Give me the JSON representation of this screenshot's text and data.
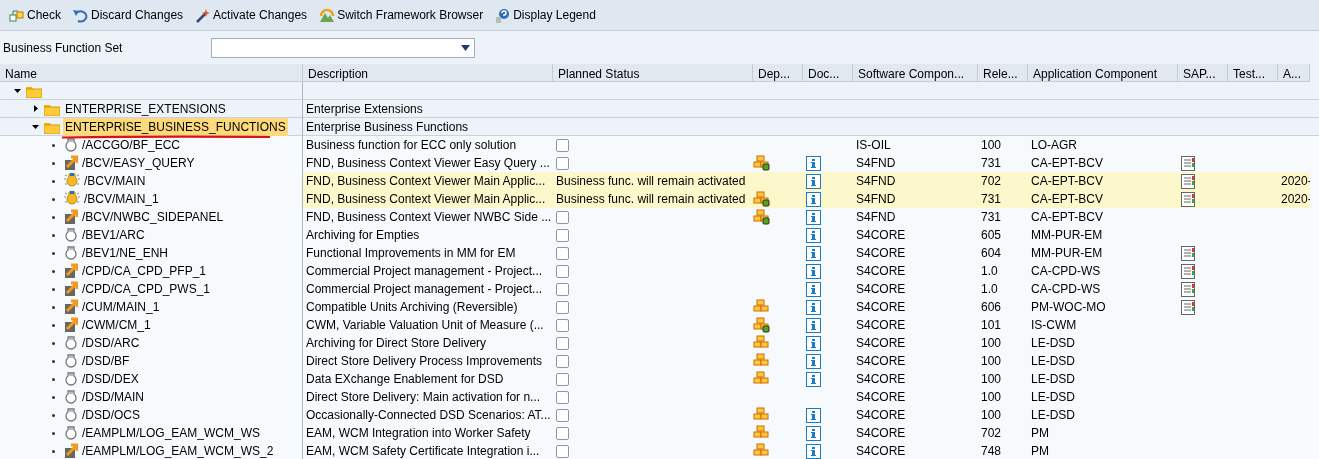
{
  "toolbar": [
    {
      "kind": "check",
      "label": "Check"
    },
    {
      "kind": "undo",
      "label": "Discard Changes"
    },
    {
      "kind": "wand",
      "label": "Activate Changes"
    },
    {
      "kind": "switch",
      "label": "Switch Framework Browser"
    },
    {
      "kind": "help",
      "label": "Display Legend"
    }
  ],
  "set_field": {
    "label": "Business Function Set"
  },
  "columns": [
    "Name",
    "Description",
    "Planned Status",
    "Dep...",
    "Doc...",
    "Software Compon...",
    "Rele...",
    "Application Component",
    "SAP...",
    "Test...",
    "A..."
  ],
  "tree": {
    "expanded": true,
    "children": [
      {
        "name": "ENTERPRISE_EXTENSIONS",
        "description": "Enterprise Extensions",
        "expanded": false,
        "selected": false
      },
      {
        "name": "ENTERPRISE_BUSINESS_FUNCTIONS",
        "description": "Enterprise Business Functions",
        "expanded": true,
        "selected": true,
        "children": [
          {
            "kind": "bulb",
            "name": "/ACCGO/BF_ECC",
            "description": "Business function for ECC only solution",
            "active": false,
            "checked": false,
            "dependent": false,
            "doc": false,
            "software": "IS-OIL",
            "release": "100",
            "component": "LO-AGR",
            "sap_note": false
          },
          {
            "kind": "switch",
            "name": "/BCV/EASY_QUERY",
            "description": "FND, Business Context Viewer Easy Query ...",
            "active": false,
            "checked": false,
            "dependent": true,
            "dependency_met": true,
            "doc": true,
            "software": "S4FND",
            "release": "731",
            "component": "CA-EPT-BCV",
            "sap_note": true
          },
          {
            "kind": "lit",
            "name": "/BCV/MAIN",
            "description": "FND, Business Context Viewer Main Applic...",
            "active": true,
            "status": "Business func. will remain activated",
            "dependent": false,
            "doc": true,
            "software": "S4FND",
            "release": "702",
            "component": "CA-EPT-BCV",
            "sap_note": true,
            "activated": "2020-"
          },
          {
            "kind": "lit",
            "name": "/BCV/MAIN_1",
            "description": "FND, Business Context Viewer Main Applic...",
            "active": true,
            "status": "Business func. will remain activated",
            "dependent": true,
            "dependency_met": true,
            "doc": true,
            "software": "S4FND",
            "release": "731",
            "component": "CA-EPT-BCV",
            "sap_note": true,
            "activated": "2020-"
          },
          {
            "kind": "switch",
            "name": "/BCV/NWBC_SIDEPANEL",
            "description": "FND, Business Context Viewer NWBC Side ...",
            "active": false,
            "checked": false,
            "dependent": true,
            "dependency_met": true,
            "doc": true,
            "software": "S4FND",
            "release": "731",
            "component": "CA-EPT-BCV",
            "sap_note": false
          },
          {
            "kind": "bulb",
            "name": "/BEV1/ARC",
            "description": "Archiving for Empties",
            "active": false,
            "checked": false,
            "dependent": false,
            "doc": true,
            "software": "S4CORE",
            "release": "605",
            "component": "MM-PUR-EM",
            "sap_note": false
          },
          {
            "kind": "bulb",
            "name": "/BEV1/NE_ENH",
            "description": "Functional Improvements in MM for EM",
            "active": false,
            "checked": false,
            "dependent": false,
            "doc": true,
            "software": "S4CORE",
            "release": "604",
            "component": "MM-PUR-EM",
            "sap_note": true
          },
          {
            "kind": "switch",
            "name": "/CPD/CA_CPD_PFP_1",
            "description": "Commercial Project management - Project...",
            "active": false,
            "checked": false,
            "dependent": false,
            "doc": true,
            "software": "S4CORE",
            "release": "1.0",
            "component": "CA-CPD-WS",
            "sap_note": true
          },
          {
            "kind": "switch",
            "name": "/CPD/CA_CPD_PWS_1",
            "description": "Commercial Project management - Project...",
            "active": false,
            "checked": false,
            "dependent": false,
            "doc": true,
            "software": "S4CORE",
            "release": "1.0",
            "component": "CA-CPD-WS",
            "sap_note": true
          },
          {
            "kind": "switch",
            "name": "/CUM/MAIN_1",
            "description": "Compatible Units Archiving (Reversible)",
            "active": false,
            "checked": false,
            "dependent": true,
            "dependency_met": false,
            "doc": true,
            "software": "S4CORE",
            "release": "606",
            "component": "PM-WOC-MO",
            "sap_note": true
          },
          {
            "kind": "switch",
            "name": "/CWM/CM_1",
            "description": "CWM, Variable Valuation Unit of Measure (...",
            "active": false,
            "checked": false,
            "dependent": true,
            "dependency_met": true,
            "doc": true,
            "software": "S4CORE",
            "release": "101",
            "component": "IS-CWM",
            "sap_note": false
          },
          {
            "kind": "bulb",
            "name": "/DSD/ARC",
            "description": "Archiving for Direct Store Delivery",
            "active": false,
            "checked": false,
            "dependent": true,
            "dependency_met": false,
            "doc": true,
            "software": "S4CORE",
            "release": "100",
            "component": "LE-DSD",
            "sap_note": false
          },
          {
            "kind": "bulb",
            "name": "/DSD/BF",
            "description": "Direct Store Delivery Process Improvements",
            "active": false,
            "checked": false,
            "dependent": true,
            "dependency_met": false,
            "doc": true,
            "software": "S4CORE",
            "release": "100",
            "component": "LE-DSD",
            "sap_note": false
          },
          {
            "kind": "bulb",
            "name": "/DSD/DEX",
            "description": "Data EXchange Enablement for DSD",
            "active": false,
            "checked": false,
            "dependent": true,
            "dependency_met": false,
            "doc": true,
            "software": "S4CORE",
            "release": "100",
            "component": "LE-DSD",
            "sap_note": false
          },
          {
            "kind": "bulb",
            "name": "/DSD/MAIN",
            "description": "Direct Store Delivery: Main activation for n...",
            "active": false,
            "checked": false,
            "dependent": false,
            "doc": false,
            "software": "S4CORE",
            "release": "100",
            "component": "LE-DSD",
            "sap_note": false
          },
          {
            "kind": "bulb",
            "name": "/DSD/OCS",
            "description": "Occasionally-Connected DSD Scenarios: AT...",
            "active": false,
            "checked": false,
            "dependent": true,
            "dependency_met": false,
            "doc": true,
            "software": "S4CORE",
            "release": "100",
            "component": "LE-DSD",
            "sap_note": false
          },
          {
            "kind": "bulb",
            "name": "/EAMPLM/LOG_EAM_WCM_WS",
            "description": "EAM, WCM Integration into Worker Safety",
            "active": false,
            "checked": false,
            "dependent": true,
            "dependency_met": false,
            "doc": true,
            "software": "S4CORE",
            "release": "702",
            "component": "PM",
            "sap_note": false
          },
          {
            "kind": "switch",
            "name": "/EAMPLM/LOG_EAM_WCM_WS_2",
            "description": "EAM, WCM Safety Certificate Integration i...",
            "active": false,
            "checked": false,
            "dependent": true,
            "dependency_met": false,
            "doc": true,
            "software": "S4CORE",
            "release": "748",
            "component": "PM",
            "sap_note": false
          }
        ]
      }
    ]
  }
}
